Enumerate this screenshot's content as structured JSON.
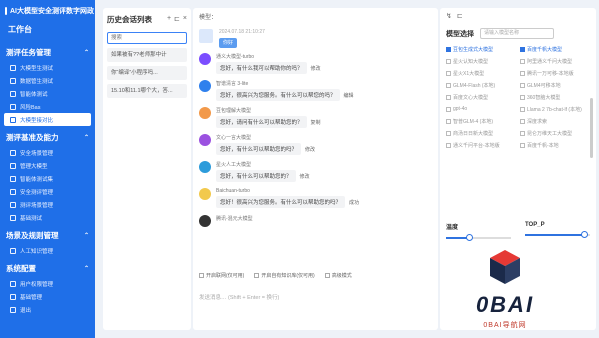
{
  "brand": {
    "title": "AI大模型安全测评数字网政"
  },
  "sidebar": {
    "workspace": "工作台",
    "sections": [
      {
        "title": "测评任务管理",
        "items": [
          {
            "label": "大模型生测试"
          },
          {
            "label": "数据管生测试"
          },
          {
            "label": "智能体测试"
          },
          {
            "label": "风险Bas"
          },
          {
            "label": "大模型接对比",
            "active": true
          }
        ]
      },
      {
        "title": "测评基准及能力",
        "items": [
          {
            "label": "安全场景管理"
          },
          {
            "label": "管理大模型"
          },
          {
            "label": "智能体测试集"
          },
          {
            "label": "安全测评管理"
          },
          {
            "label": "测评场景管理"
          },
          {
            "label": "基础测试"
          }
        ]
      },
      {
        "title": "场景及规则管理",
        "items": [
          {
            "label": "人工知识管理"
          }
        ]
      },
      {
        "title": "系统配置",
        "items": [
          {
            "label": "用户权限管理"
          },
          {
            "label": "基础管理"
          },
          {
            "label": "退出"
          }
        ]
      }
    ]
  },
  "history": {
    "title": "历史会话列表",
    "search_placeholder": "搜索",
    "items": [
      "如果被有??老师那中计",
      "你“编译”小程序吗...",
      "15.10和11.1哪个大，答..."
    ]
  },
  "chat": {
    "title": "模型：",
    "user_time": "2024.07.18 21:10:27",
    "user_bubble": "你好",
    "replies": [
      {
        "name": "通义大模型-turbo",
        "text": "您好，有什么我可以帮助你的吗？",
        "action": "修改",
        "color": "#7b4dff"
      },
      {
        "name": "智谱清言 3-lite",
        "text": "您好，很高兴为您服务。有什么可以帮您的吗？",
        "action": "编辑",
        "color": "#2f80ed"
      },
      {
        "name": "豆包理解大模型",
        "text": "您好，请问有什么可以帮助您的？",
        "action": "复制",
        "color": "#f2994a"
      },
      {
        "name": "文心一言大模型",
        "text": "您好，有什么可以帮助您的吗？",
        "action": "修改",
        "color": "#9b51e0"
      },
      {
        "name": "星火人工大模型",
        "text": "您好，有什么可以帮助您的？",
        "action": "修改",
        "color": "#2d9cdb"
      },
      {
        "name": "Baichuan-turbo",
        "text": "您好！很高兴为您服务。有什么可以帮助您的吗？",
        "action": "成功",
        "color": "#f2c94c"
      },
      {
        "name": "腾讯-混元大模型",
        "text": "",
        "action": "",
        "color": "#333333"
      }
    ],
    "checks": [
      "开启联网(仅可用)",
      "开启自有知识库(仅可用)",
      "高级模式"
    ],
    "input_hint": "发送消息… (Shift + Enter = 换行)"
  },
  "right": {
    "tools": [
      "↯",
      "⊏"
    ],
    "model_label": "模型选择",
    "model_search_placeholder": "请输入模型名称",
    "models": [
      {
        "label": "豆包生成式大模型",
        "checked": true
      },
      {
        "label": "百度千帆大模型",
        "checked": true
      },
      {
        "label": "星火认知大模型",
        "checked": false
      },
      {
        "label": "阿里通义千问大模型",
        "checked": false
      },
      {
        "label": "星火X1大模型",
        "checked": false
      },
      {
        "label": "腾讯一万可移-本地版",
        "checked": false
      },
      {
        "label": "GLM4-Flash (本地)",
        "checked": false
      },
      {
        "label": "GLM4可移本地",
        "checked": false
      },
      {
        "label": "百度文心大模型",
        "checked": false
      },
      {
        "label": "360智脑大模型",
        "checked": false
      },
      {
        "label": "gpt-4o",
        "checked": false
      },
      {
        "label": "Llama 2 7b-chat-lf (本地)",
        "checked": false
      },
      {
        "label": "智普GLM-4 (本地)",
        "checked": false
      },
      {
        "label": "深度求索",
        "checked": false
      },
      {
        "label": "商汤日日新大模型",
        "checked": false
      },
      {
        "label": "昆仑万维天工大模型",
        "checked": false
      },
      {
        "label": "通义千问平台-本地版",
        "checked": false
      },
      {
        "label": "百度千帆-本地",
        "checked": false
      }
    ],
    "temp_label": "温度",
    "temp_value": 0.35,
    "topp_label": "TOP_P",
    "topp_value": 0.9
  },
  "watermark": {
    "text": "0BAI",
    "sub": "0BAI导航网"
  }
}
